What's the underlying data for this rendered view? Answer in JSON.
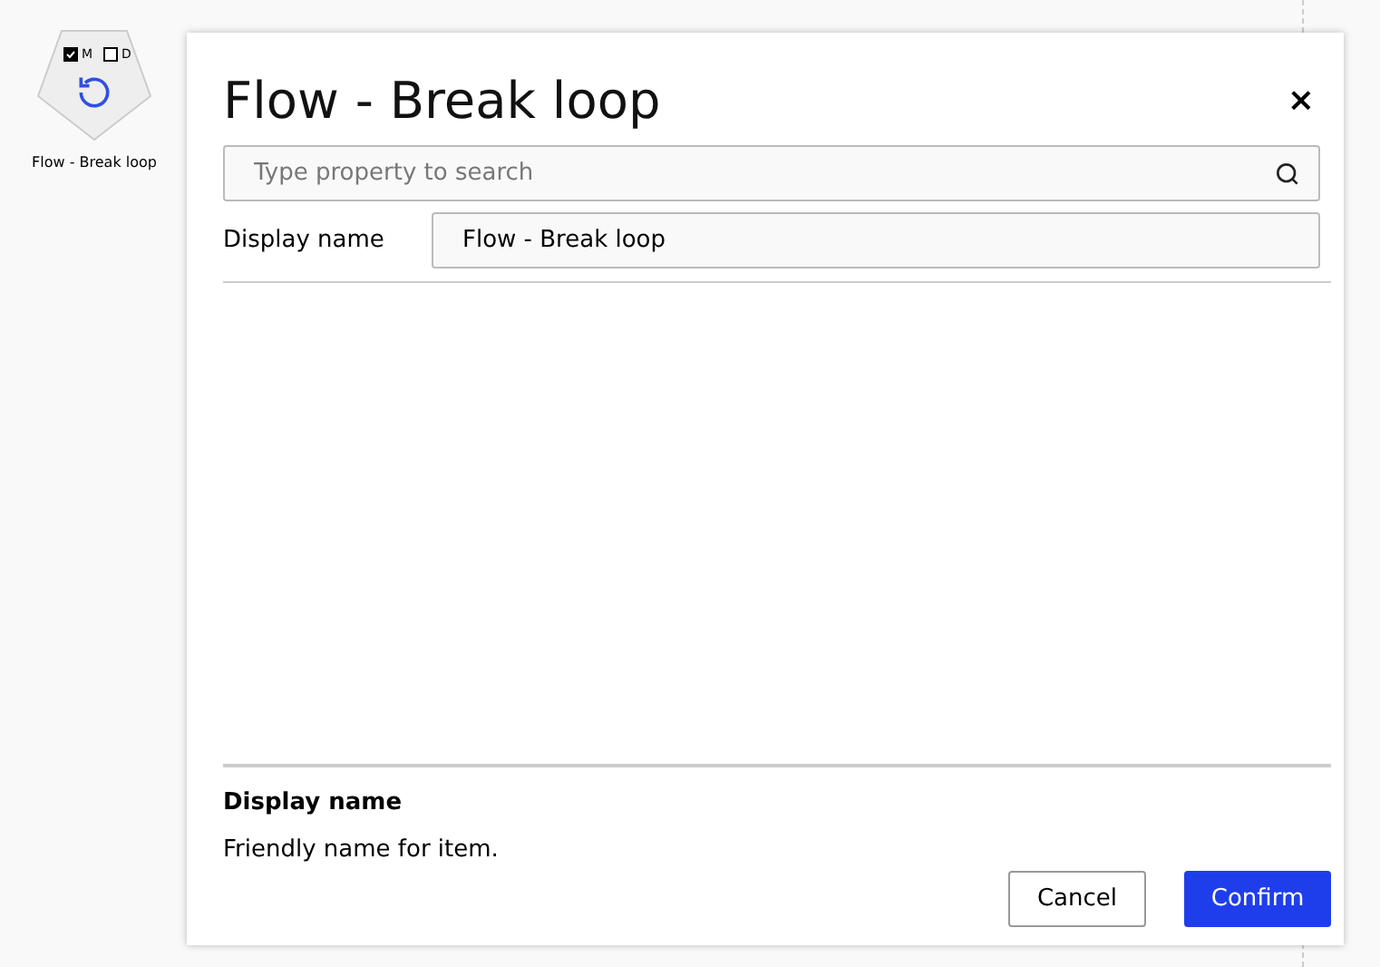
{
  "canvas_node": {
    "label": "Flow - Break loop",
    "checkboxes": [
      {
        "label": "M",
        "checked": true
      },
      {
        "label": "D",
        "checked": false
      }
    ]
  },
  "dialog": {
    "title": "Flow - Break loop",
    "close": "×",
    "search": {
      "placeholder": "Type property to search"
    },
    "fields": [
      {
        "label": "Display name",
        "value": "Flow - Break loop"
      }
    ],
    "help": {
      "title": "Display name",
      "text": "Friendly name for item."
    },
    "buttons": [
      {
        "label": "Cancel",
        "kind": "secondary"
      },
      {
        "label": "Confirm",
        "kind": "primary"
      }
    ]
  }
}
